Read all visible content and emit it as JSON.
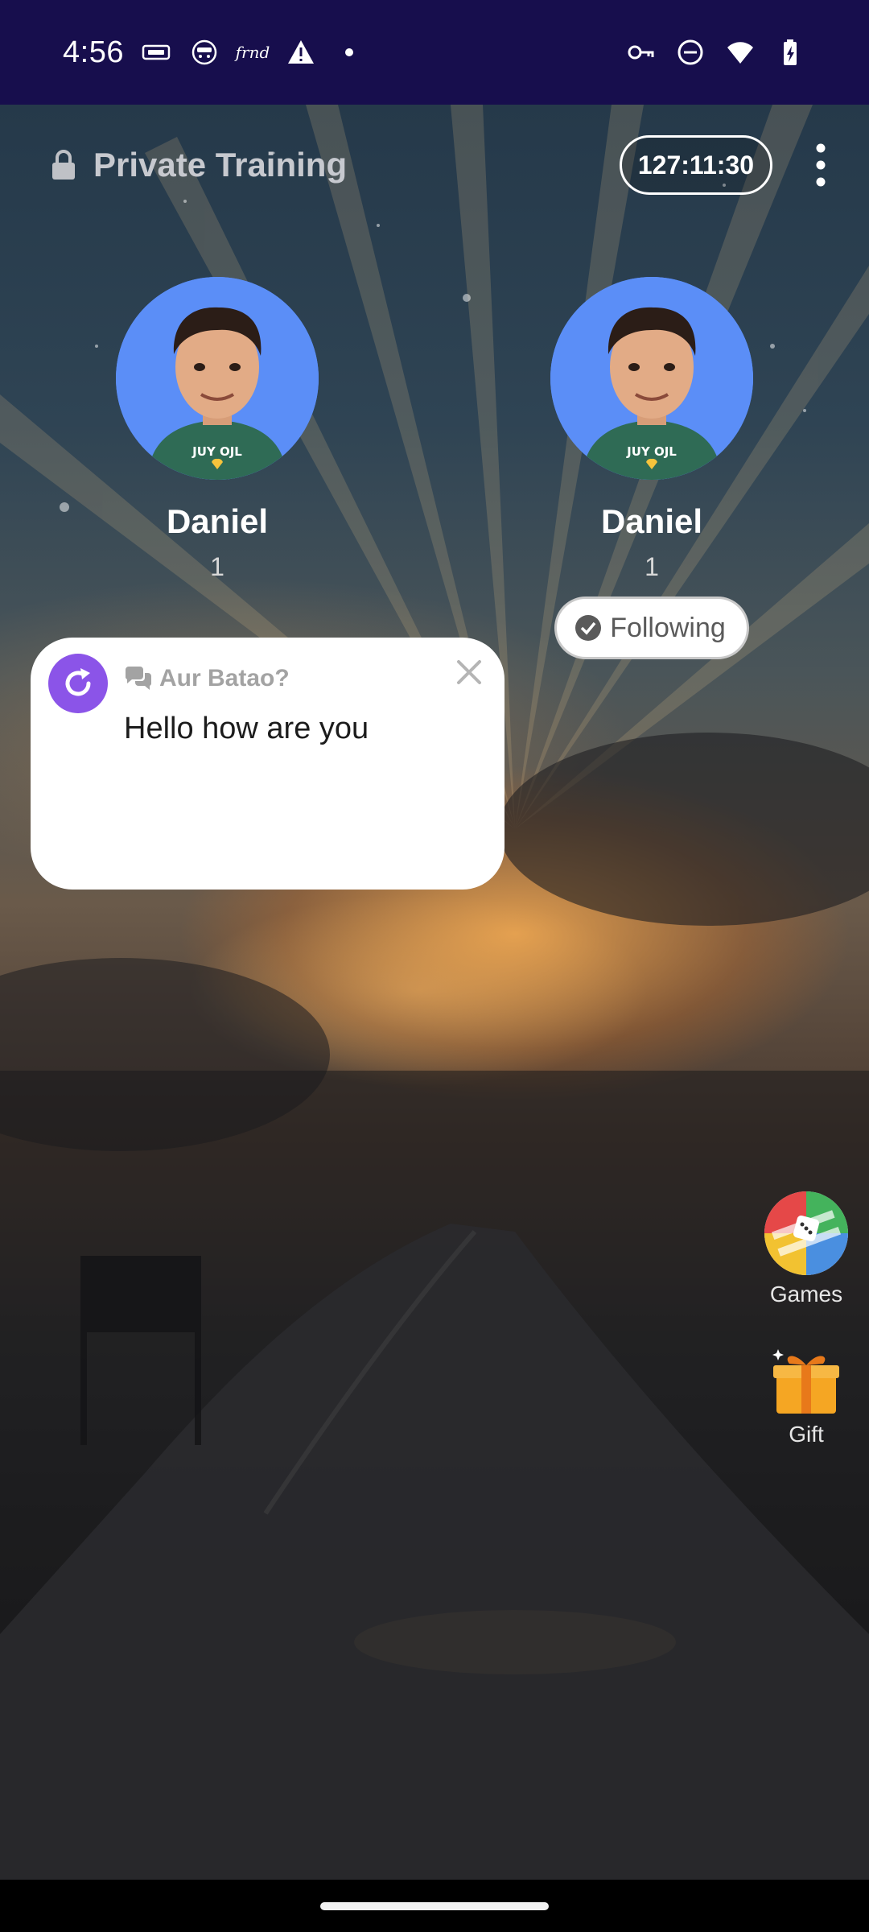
{
  "status_bar": {
    "time": "4:56",
    "frnd_label": "frnd",
    "icons_left": [
      "keyboard-icon",
      "app-face-icon",
      "frnd-icon",
      "warning-icon",
      "dot-icon"
    ],
    "icons_right": [
      "vpn-key-icon",
      "dnd-icon",
      "wifi-icon",
      "battery-charging-icon"
    ]
  },
  "header": {
    "room_title": "Private Training",
    "timer": "127:11:30"
  },
  "participants": [
    {
      "name": "Daniel",
      "count": "1"
    },
    {
      "name": "Daniel",
      "count": "1",
      "follow_label": "Following"
    }
  ],
  "chat_popup": {
    "title": "Aur Batao?",
    "message": "Hello how are you"
  },
  "side_actions": {
    "games_label": "Games",
    "gift_label": "Gift"
  },
  "colors": {
    "status_bar_bg": "#170e4d",
    "accent_purple": "#8b54e8",
    "avatar_bg": "#5b8ef7"
  }
}
